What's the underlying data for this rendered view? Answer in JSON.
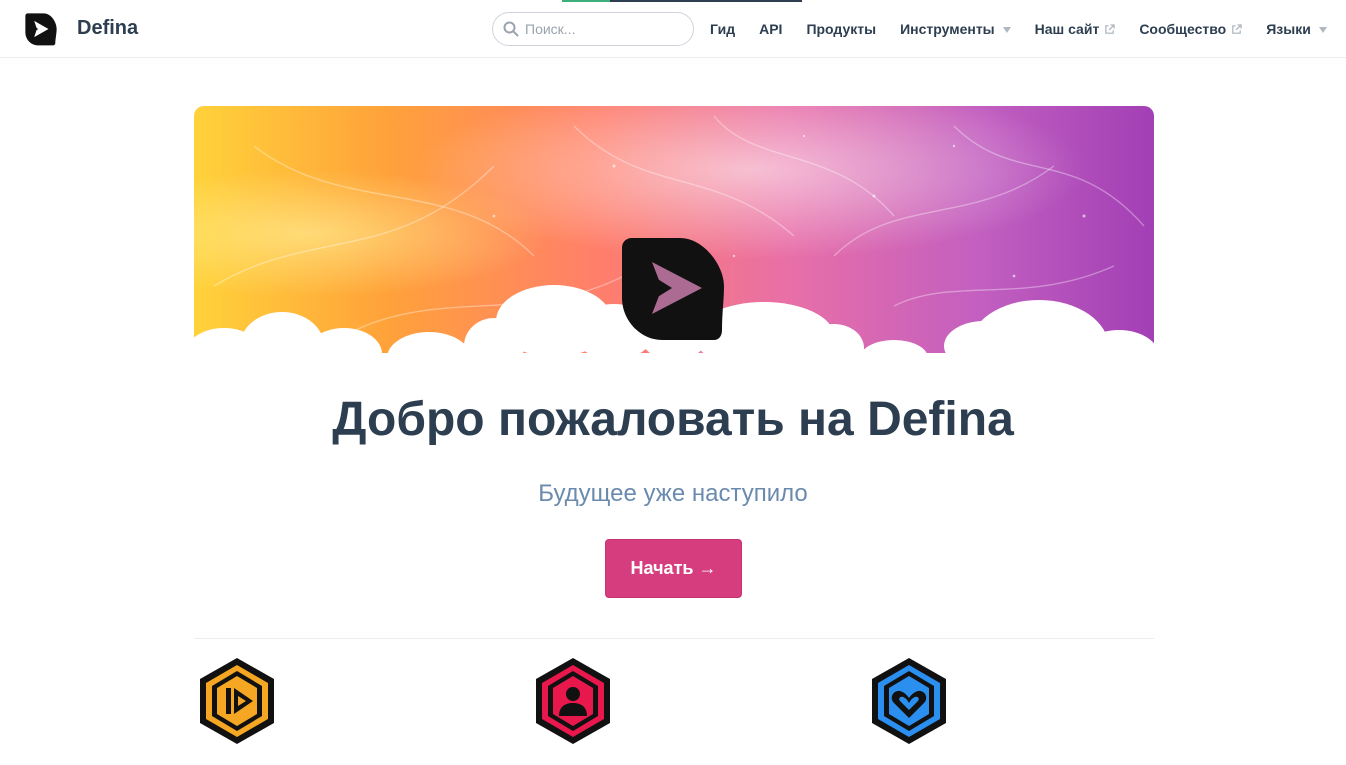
{
  "navbar": {
    "title": "Defina",
    "search": {
      "placeholder": "Поиск...",
      "value": ""
    },
    "links": [
      {
        "label": "Гид",
        "icon": null
      },
      {
        "label": "API",
        "icon": null
      },
      {
        "label": "Продукты",
        "icon": null
      },
      {
        "label": "Инструменты",
        "icon": "chevron-down-icon"
      },
      {
        "label": "Наш сайт",
        "icon": "external-link-icon"
      },
      {
        "label": "Сообщество",
        "icon": "external-link-icon"
      },
      {
        "label": "Языки",
        "icon": "chevron-down-icon"
      }
    ]
  },
  "hero": {
    "title": "Добро пожаловать на Defina",
    "subtitle": "Будущее уже наступило",
    "cta_label": "Начать →"
  },
  "features": [
    {
      "icon": "play-hexagon-icon",
      "color": "#f5a623"
    },
    {
      "icon": "user-hexagon-icon",
      "color": "#e8184d"
    },
    {
      "icon": "heart-hexagon-icon",
      "color": "#2b8ff0"
    }
  ],
  "colors": {
    "accent": "#d63d7e",
    "text": "#2c3e50",
    "subtitle": "#6a8bad",
    "border": "#eaecef"
  }
}
